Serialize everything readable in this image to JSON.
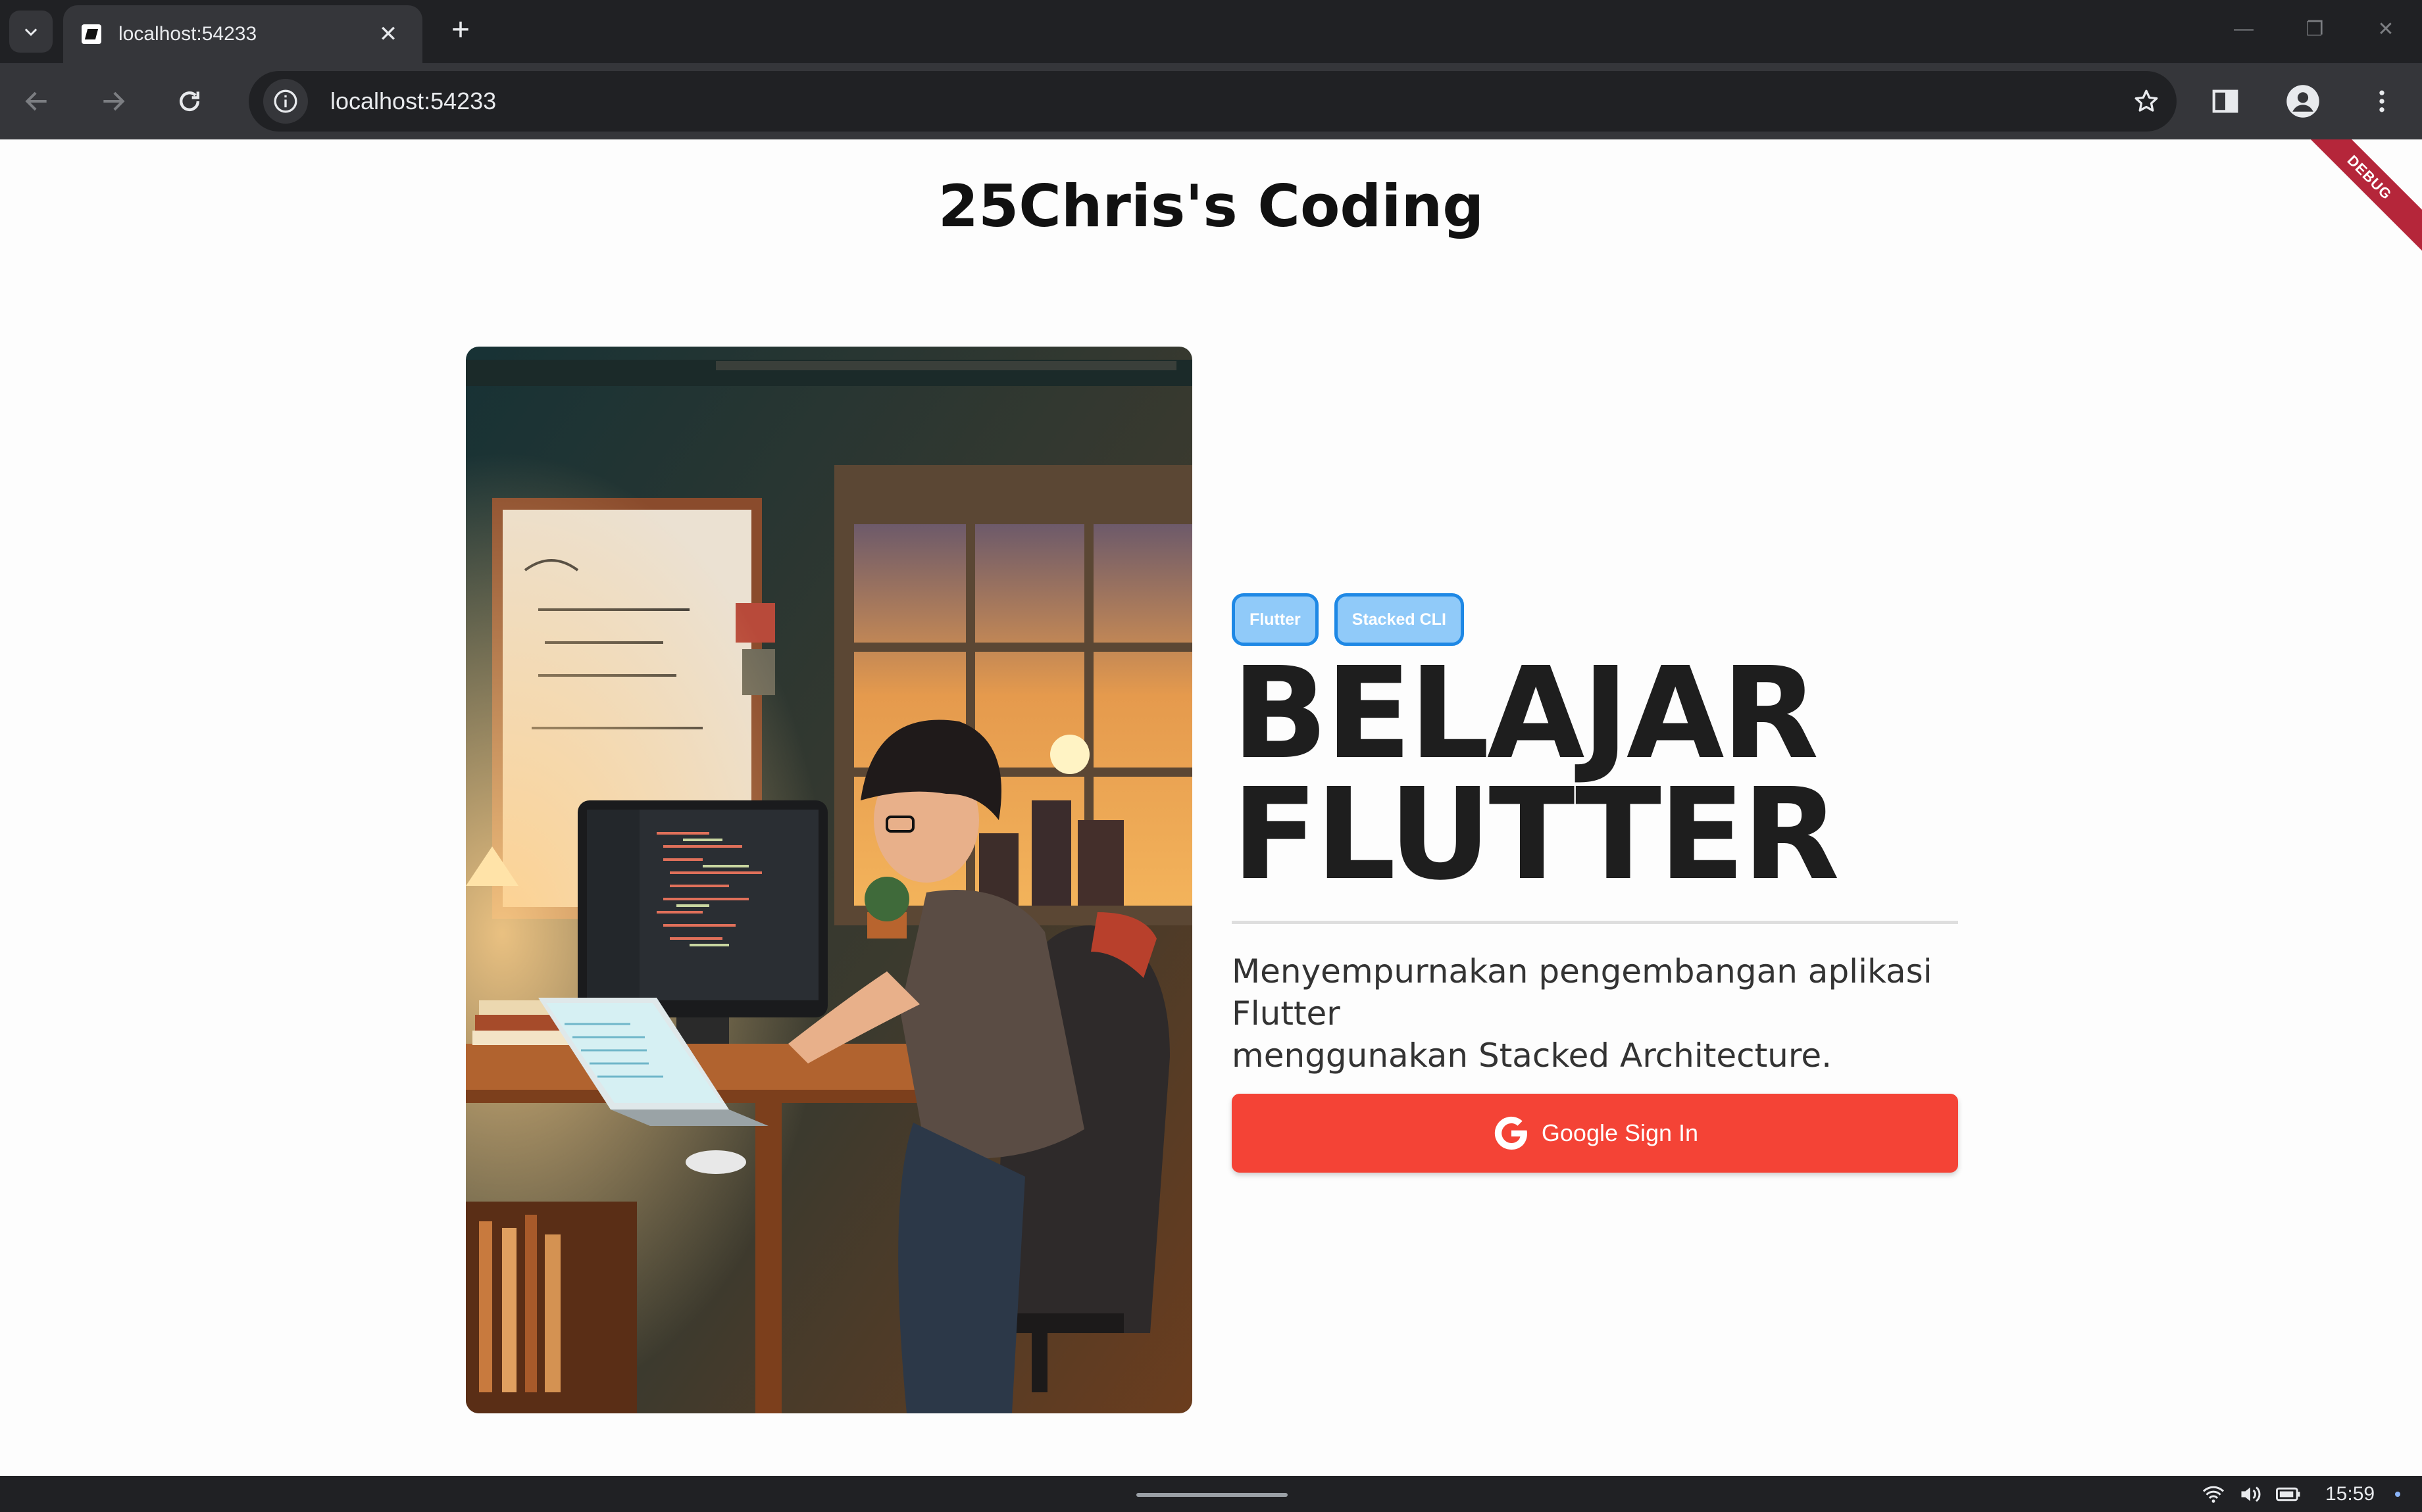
{
  "browser": {
    "tab": {
      "title": "localhost:54233"
    },
    "new_tab_label": "+",
    "address_bar": {
      "url": "localhost:54233"
    },
    "window_controls": {
      "minimize": "—",
      "restore": "❐",
      "close": "✕"
    }
  },
  "page": {
    "debug_banner": "DEBUG",
    "site_title": "25Chris's Coding",
    "hero_image": {
      "alt": "Illustration of a young person coding at a desk with a monitor and laptop by a window at sunset"
    },
    "chips": [
      {
        "label": "Flutter"
      },
      {
        "label": "Stacked CLI"
      }
    ],
    "headline": [
      "BELAJAR",
      "FLUTTER"
    ],
    "subtitle": [
      "Menyempurnakan pengembangan aplikasi",
      "Flutter",
      "menggunakan Stacked Architecture."
    ],
    "sign_in_button": {
      "label": "Google Sign In"
    }
  },
  "taskbar": {
    "clock": "15:59"
  },
  "colors": {
    "chip_bg": "#90caf9",
    "chip_border": "#1e88e5",
    "button_bg": "#f44336",
    "debug_banner": "#b5263a",
    "page_bg": "#fdfdfd"
  }
}
